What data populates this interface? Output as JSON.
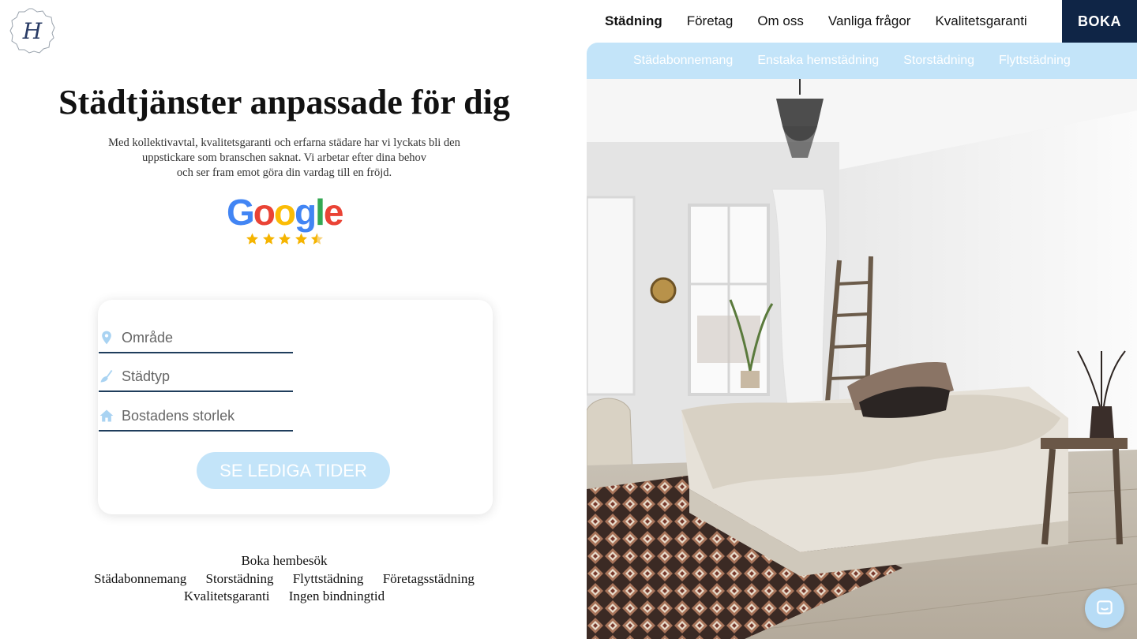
{
  "logo": {
    "letter": "H"
  },
  "topnav": {
    "items": [
      "Städning",
      "Företag",
      "Om oss",
      "Vanliga frågor",
      "Kvalitetsgaranti"
    ],
    "active": "Städning",
    "boka_label": "BOKA"
  },
  "subnav": {
    "items": [
      "Städabonnemang",
      "Enstaka hemstädning",
      "Storstädning",
      "Flyttstädning"
    ]
  },
  "hero": {
    "title": "Städtjänster anpassade för dig",
    "description_lines": [
      "Med kollektivavtal, kvalitetsgaranti och erfarna städare har vi lyckats bli den",
      "uppstickare som branschen saknat.  Vi arbetar efter dina behov",
      "och ser fram emot göra din vardag till en fröjd."
    ]
  },
  "google_rating": {
    "word": "Google",
    "stars": 4.5
  },
  "booking_form": {
    "area_placeholder": "Område",
    "type_placeholder": "Städtyp",
    "size_placeholder": "Bostadens storlek",
    "submit_label": "SE LEDIGA TIDER"
  },
  "footer_links": {
    "row1": [
      "Boka hembesök"
    ],
    "row2": [
      "Städabonnemang",
      "Storstädning",
      "Flyttstädning",
      "Företagsstädning"
    ],
    "row3": [
      "Kvalitetsgaranti",
      "Ingen bindningtid"
    ]
  },
  "colors": {
    "navy": "#0f2546",
    "light_blue": "#c3e4f9",
    "field_icon": "#a9d3f2"
  },
  "icons": [
    "location-pin-icon",
    "broom-icon",
    "home-icon",
    "star-icon",
    "chat-icon"
  ]
}
